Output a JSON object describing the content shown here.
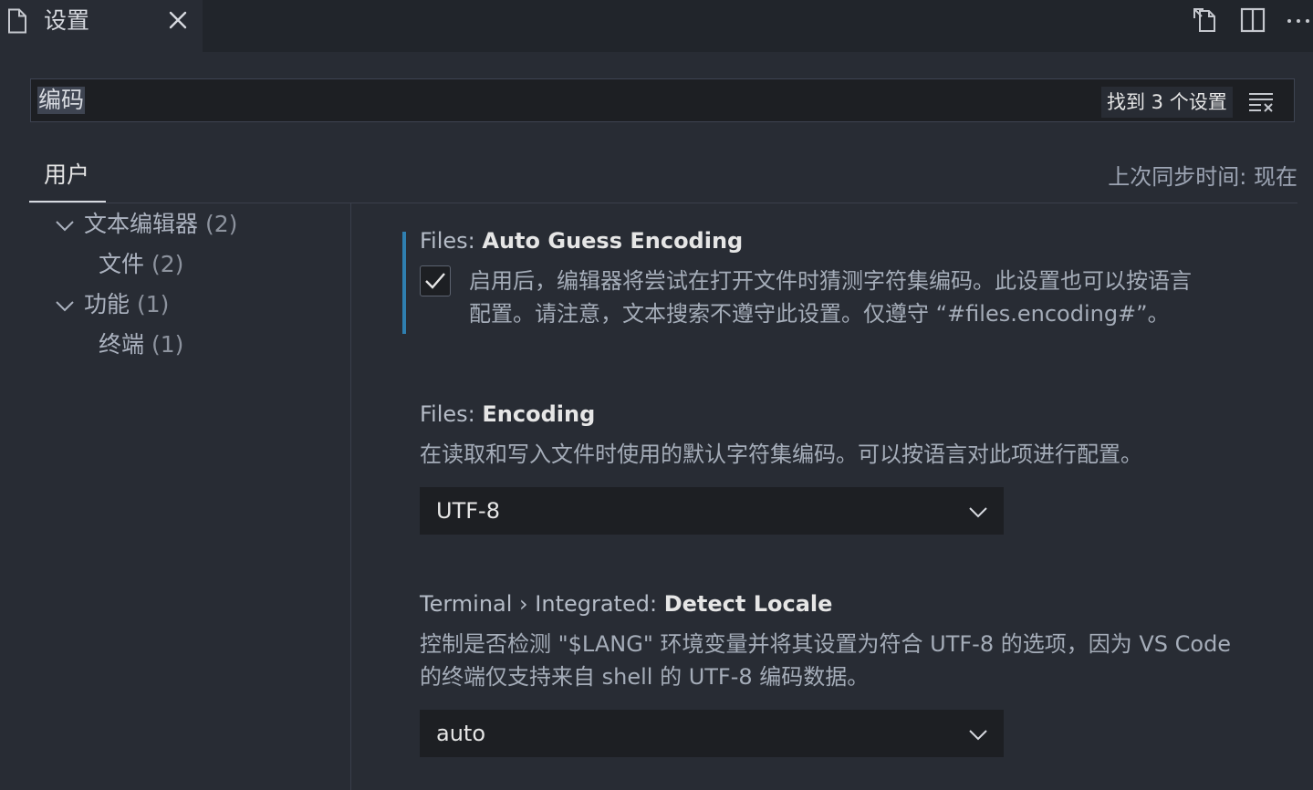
{
  "tab": {
    "title": "设置",
    "file_icon": "file-icon",
    "close_icon": "close-icon"
  },
  "editor_actions": [
    {
      "name": "open-settings-json-icon"
    },
    {
      "name": "split-editor-icon"
    },
    {
      "name": "more-actions-icon"
    }
  ],
  "search": {
    "value": "编码",
    "result_count": "找到 3 个设置",
    "filter_icon": "filter-clear-icon"
  },
  "scope": {
    "tab_label": "用户",
    "sync_status": "上次同步时间: 现在"
  },
  "toc": [
    {
      "label": "文本编辑器",
      "count": "(2)",
      "expanded": true,
      "level": 0
    },
    {
      "label": "文件",
      "count": "(2)",
      "level": 1
    },
    {
      "label": "功能",
      "count": "(1)",
      "expanded": true,
      "level": 0
    },
    {
      "label": "终端",
      "count": "(1)",
      "level": 1
    }
  ],
  "settings": {
    "auto_guess": {
      "category": "Files: ",
      "key": "Auto Guess Encoding",
      "checked": true,
      "description_line1": "启用后，编辑器将尝试在打开文件时猜测字符集编码。此设置也可以按语言",
      "description_line2": "配置。请注意，文本搜索不遵守此设置。仅遵守 “#files.encoding#”。"
    },
    "encoding": {
      "category": "Files: ",
      "key": "Encoding",
      "description": "在读取和写入文件时使用的默认字符集编码。可以按语言对此项进行配置。",
      "value": "UTF-8"
    },
    "detect_locale": {
      "category": "Terminal › Integrated: ",
      "key": "Detect Locale",
      "description_line1": "控制是否检测 \"$LANG\" 环境变量并将其设置为符合 UTF-8 的选项，因为 VS Code",
      "description_line2": "的终端仅支持来自 shell 的 UTF-8 编码数据。",
      "value": "auto"
    }
  },
  "colors": {
    "accent": "#2f7fb0",
    "background": "#282c34",
    "input_bg": "#1d1f23"
  }
}
